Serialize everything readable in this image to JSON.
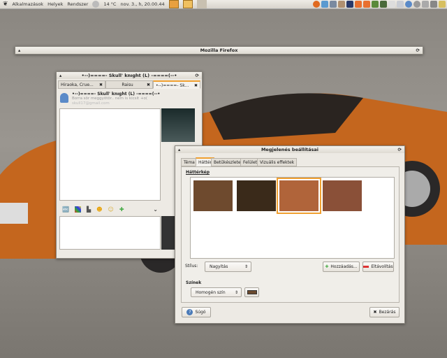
{
  "panel": {
    "menus": [
      "Alkalmazások",
      "Helyek",
      "Rendszer"
    ],
    "weather": "14 °C",
    "clock": "nov. 3., h, 20.00.44",
    "tray_icons": [
      "firefox-icon",
      "contacts-icon",
      "network-icon",
      "package-icon",
      "workspace-icon",
      "upload-icon",
      "download-icon",
      "terminal-icon",
      "calculator-icon",
      "editor-icon",
      "screenshot-icon",
      "user-icon",
      "settings-icon",
      "network-status-icon",
      "volume-icon",
      "power-icon"
    ]
  },
  "firefox_window": {
    "title": "Mozilla Firefox"
  },
  "chat": {
    "title": "•--)====- Skull' knıght   (L) -====(--•",
    "tabs": [
      "Hiraoka, Crue...",
      "Raisu",
      "•--)====- Sk..."
    ],
    "contact_name": "•--)====- Skull' knıght   (L) -====(--•",
    "status": "Borra sör meggyötör.. nem is kicsit +o(",
    "email": "skull17@gmail.com",
    "toolbar_icons": [
      "font-icon",
      "color-icon",
      "nudge-icon",
      "smiley-icon",
      "wink-icon",
      "add-icon",
      "chevron-down-icon"
    ]
  },
  "dialog": {
    "title": "Megjelenés beállításai",
    "tabs": [
      "Téma",
      "Háttér",
      "Betűkészletek",
      "Felület",
      "Vizuális effektek"
    ],
    "active_tab": "Háttér",
    "section_wallpaper": "Háttérkép",
    "wallpapers": [
      {
        "color": "#6e4a2e",
        "selected": false
      },
      {
        "color": "#3a2a1a",
        "selected": false
      },
      {
        "color": "#b0643a",
        "selected": true
      },
      {
        "color": "#8a5038",
        "selected": false
      }
    ],
    "style_label": "Stílus:",
    "style_value": "Nagyítás",
    "add_button": "Hozzáadás...",
    "remove_button": "Eltávolítás",
    "section_colors": "Színek",
    "color_mode": "Homogén szín",
    "color_value": "#6b4a2e",
    "help_button": "Súgó",
    "close_button": "Bezárás"
  }
}
